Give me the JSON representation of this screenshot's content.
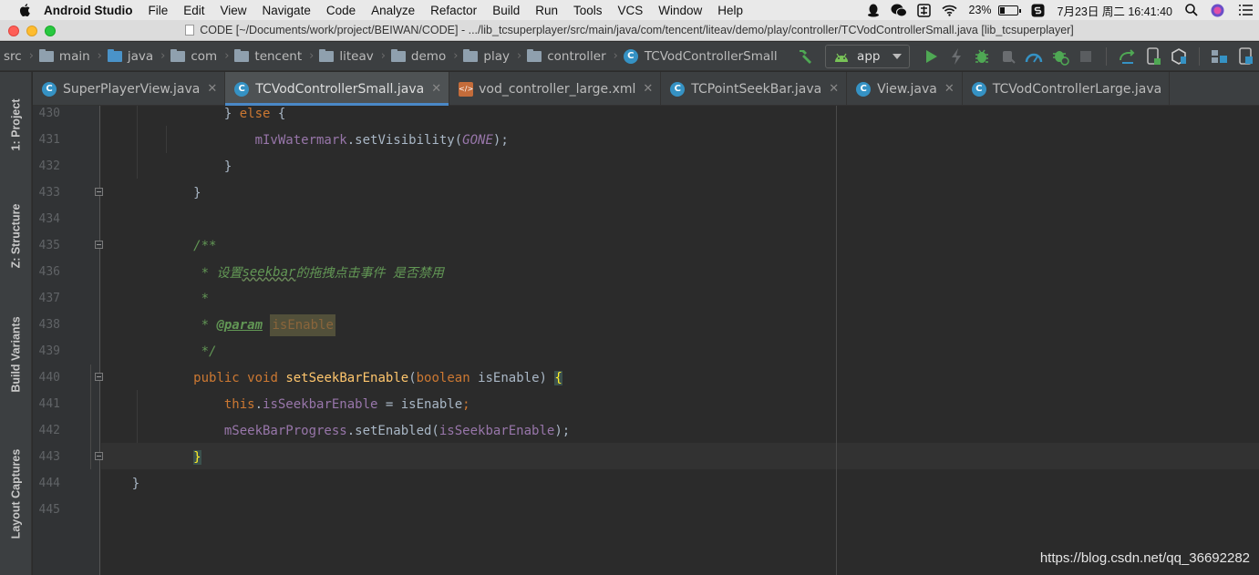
{
  "menubar": {
    "app_name": "Android Studio",
    "items": [
      "File",
      "Edit",
      "View",
      "Navigate",
      "Code",
      "Analyze",
      "Refactor",
      "Build",
      "Run",
      "Tools",
      "VCS",
      "Window",
      "Help"
    ],
    "battery": "23%",
    "datetime": "7月23日 周二  16:41:40"
  },
  "window": {
    "title": "CODE [~/Documents/work/project/BEIWAN/CODE] - .../lib_tcsuperplayer/src/main/java/com/tencent/liteav/demo/play/controller/TCVodControllerSmall.java [lib_tcsuperplayer]"
  },
  "breadcrumb": [
    "src",
    "main",
    "java",
    "com",
    "tencent",
    "liteav",
    "demo",
    "play",
    "controller",
    "TCVodControllerSmall"
  ],
  "toolbar": {
    "run_config": "app"
  },
  "left_tools": [
    "1: Project",
    "Z: Structure",
    "Build Variants",
    "Layout Captures"
  ],
  "tabs": [
    {
      "label": "SuperPlayerView.java",
      "icon": "class-icon"
    },
    {
      "label": "TCVodControllerSmall.java",
      "icon": "class-icon",
      "active": true
    },
    {
      "label": "vod_controller_large.xml",
      "icon": "xml-icon"
    },
    {
      "label": "TCPointSeekBar.java",
      "icon": "class-icon"
    },
    {
      "label": "View.java",
      "icon": "class-icon"
    },
    {
      "label": "TCVodControllerLarge.java",
      "icon": "class-icon"
    }
  ],
  "code": {
    "lines": [
      "430",
      "431",
      "432",
      "433",
      "434",
      "435",
      "436",
      "437",
      "438",
      "439",
      "440",
      "441",
      "442",
      "443",
      "444",
      "445"
    ],
    "l430_kw": "else",
    "l431_obj": "mIvWatermark",
    "l431_call": ".setVisibility(",
    "l431_const": "GONE",
    "l431_end": ");",
    "l435": "/**",
    "l436_a": " * 设置",
    "l436_b": "seekbar",
    "l436_c": "的拖拽点击事件 是否禁用",
    "l437": " *",
    "l438_a": " * ",
    "l438_tag": "@param",
    "l438_param": "isEnable",
    "l439": " */",
    "l440_public": "public",
    "l440_void": "void",
    "l440_name": "setSeekBarEnable",
    "l440_boolean": "boolean",
    "l440_arg": " isEnable) ",
    "l441_this": "this",
    "l441_field": "isSeekbarEnable",
    "l441_rest": " = isEnable",
    "l442_obj": "mSeekBarProgress",
    "l442_call": ".setEnabled(",
    "l442_field": "isSeekbarEnable",
    "l442_end": ");"
  },
  "watermark": "https://blog.csdn.net/qq_36692282"
}
